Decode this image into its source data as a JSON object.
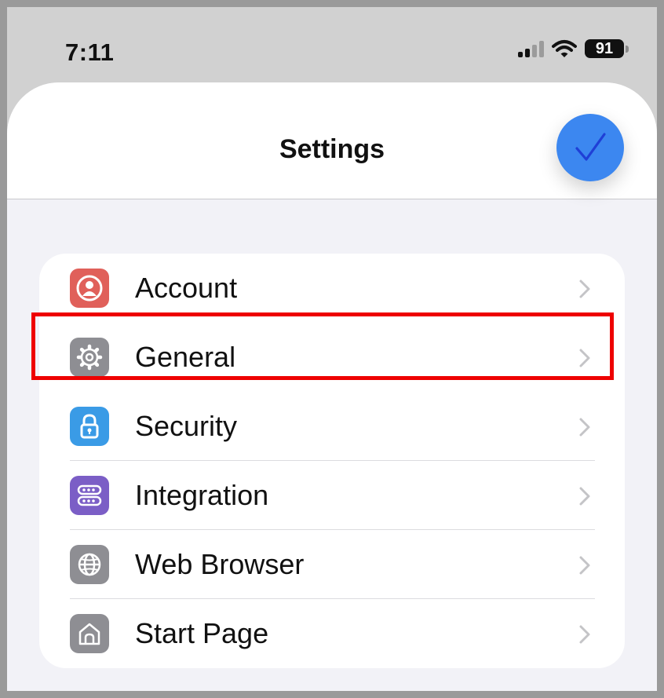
{
  "status_bar": {
    "time": "7:11",
    "battery_level": "91"
  },
  "sheet": {
    "title": "Settings",
    "done_icon": "checkmark-icon"
  },
  "settings_group": {
    "items": [
      {
        "label": "Account",
        "icon": "person-circle-icon",
        "color": "#e0605a"
      },
      {
        "label": "General",
        "icon": "gear-icon",
        "color": "#8e8e93"
      },
      {
        "label": "Security",
        "icon": "lock-icon",
        "color": "#3a9be6"
      },
      {
        "label": "Integration",
        "icon": "server-icon",
        "color": "#7b5ec6"
      },
      {
        "label": "Web Browser",
        "icon": "globe-icon",
        "color": "#8e8e93"
      },
      {
        "label": "Start Page",
        "icon": "house-icon",
        "color": "#8e8e93"
      }
    ]
  },
  "highlight": {
    "target": "General",
    "color": "#ee0000"
  }
}
